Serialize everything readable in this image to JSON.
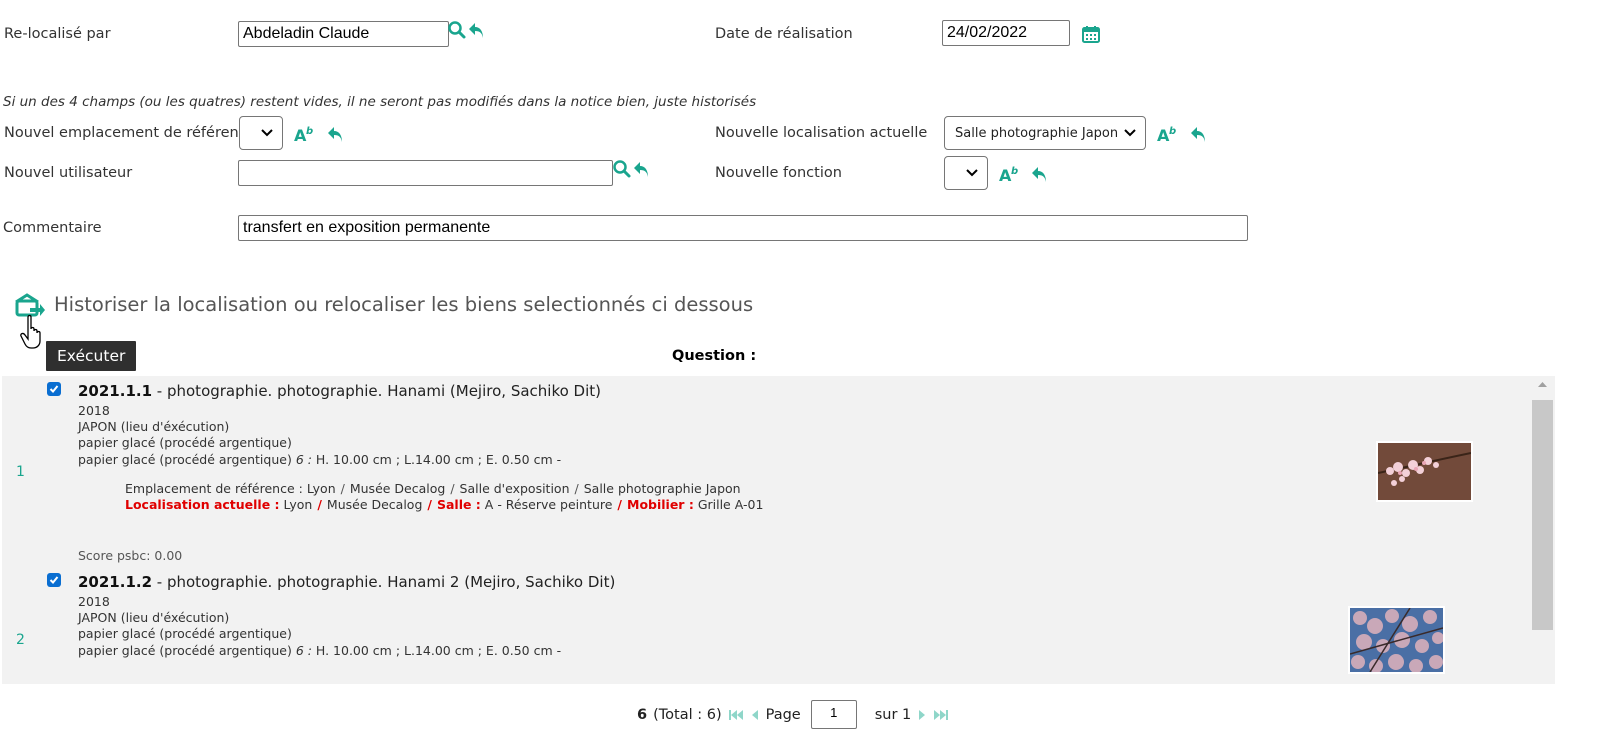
{
  "form": {
    "relocalise_label": "Re-localisé par",
    "relocalise_value": "Abdeladin Claude",
    "date_label": "Date de réalisation",
    "date_value": "24/02/2022",
    "note": "Si un des 4 champs (ou les quatres) restent vides, il ne seront pas modifiés dans la notice bien, juste historisés",
    "emplacement_label": "Nouvel emplacement de référence",
    "emplacement_value": "",
    "localisation_label": "Nouvelle localisation actuelle",
    "localisation_value": "Salle photographie Japon",
    "utilisateur_label": "Nouvel utilisateur",
    "utilisateur_value": "",
    "fonction_label": "Nouvelle fonction",
    "fonction_value": "",
    "commentaire_label": "Commentaire",
    "commentaire_value": "transfert en exposition permanente"
  },
  "action": {
    "title": "Historiser la localisation ou relocaliser les biens selectionnés ci dessous",
    "tooltip": "Exécuter",
    "question": "Question :"
  },
  "results": [
    {
      "index": "1",
      "checked": true,
      "id": "2021.1.1",
      "title": " - photographie. photographie. Hanami (Mejiro, Sachiko Dit)",
      "year": "2018",
      "place": "JAPON (lieu d'éxécution)",
      "material": "papier glacé (procédé argentique)",
      "material2": "papier glacé (procédé argentique)",
      "dims_num": "6 :",
      "dims": " H. 10.00 cm ; L.14.00 cm ; E. 0.50 cm -",
      "ref_label": "Emplacement de référence :",
      "ref_parts": [
        "Lyon",
        "Musée Decalog",
        "Salle d'exposition",
        "Salle photographie Japon"
      ],
      "loc_label": "Localisation actuelle :",
      "loc_city": "Lyon",
      "loc_museum": "Musée Decalog",
      "salle_label": "Salle :",
      "salle_value": "A - Réserve peinture",
      "mobilier_label": "Mobilier :",
      "mobilier_value": "Grille A-01",
      "score": "Score psbc: 0.00"
    },
    {
      "index": "2",
      "checked": true,
      "id": "2021.1.2",
      "title": " - photographie. photographie. Hanami 2 (Mejiro, Sachiko Dit)",
      "year": "2018",
      "place": "JAPON (lieu d'éxécution)",
      "material": "papier glacé (procédé argentique)",
      "material2": "papier glacé (procédé argentique)",
      "dims_num": "6 :",
      "dims": " H. 10.00 cm ; L.14.00 cm ; E. 0.50 cm -"
    }
  ],
  "pager": {
    "count": "6",
    "total": "(Total : 6)",
    "page_label": "Page",
    "page_value": "1",
    "of": "sur 1"
  },
  "colors": {
    "accent": "#1aa58e",
    "highlight": "#e00000",
    "row_bg": "#f2f2f2"
  }
}
